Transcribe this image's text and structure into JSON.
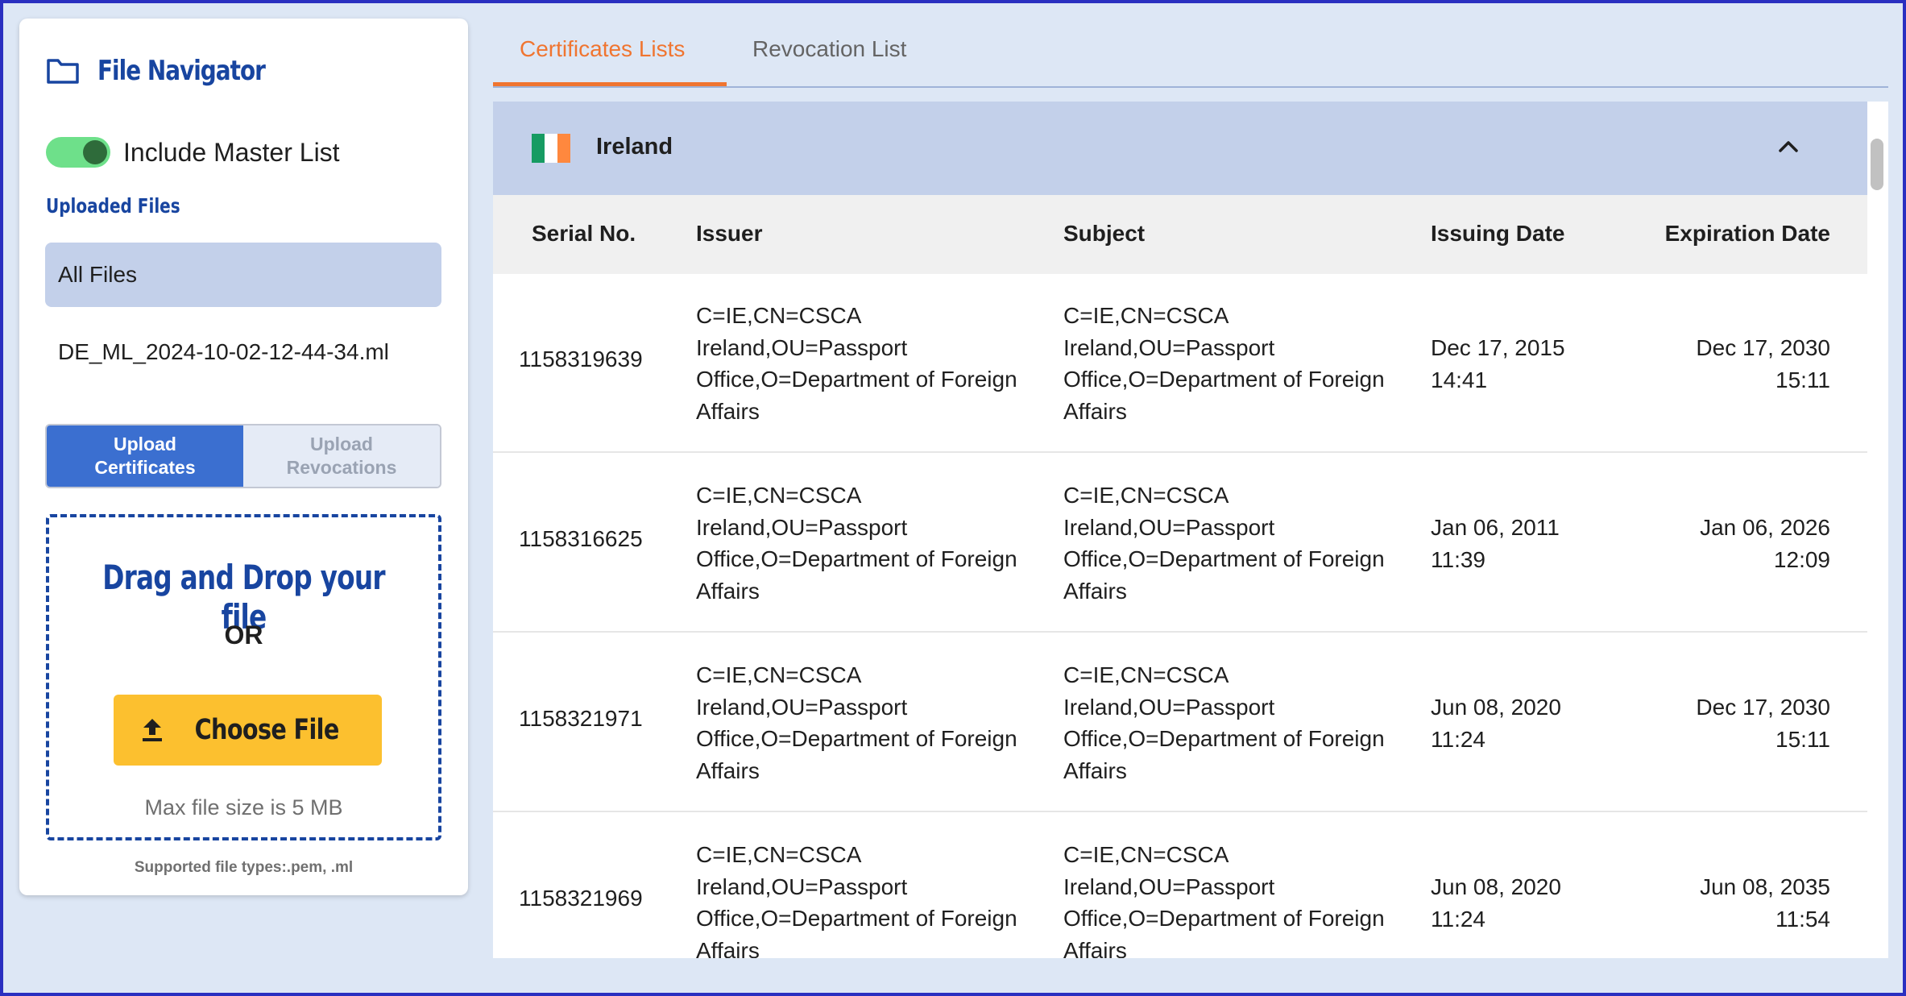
{
  "sidebar": {
    "title": "File Navigator",
    "include_master_label": "Include Master List",
    "include_master_on": true,
    "uploaded_files_label": "Uploaded Files",
    "files": [
      "All Files",
      "DE_ML_2024-10-02-12-44-34.ml"
    ],
    "selected_file": "All Files",
    "upload_modes": [
      "Upload\nCertificates",
      "Upload\nRevocations"
    ],
    "active_upload_mode": "Upload\nCertificates",
    "dropzone": {
      "title": "Drag and Drop your file",
      "or_text": "OR",
      "button_label": "Choose File",
      "max_size_text": "Max file size is 5 MB"
    },
    "supported_types": "Supported file types:.pem, .ml"
  },
  "tabs": [
    "Certificates Lists",
    "Revocation List"
  ],
  "active_tab": "Certificates Lists",
  "group": {
    "country": "Ireland",
    "expanded": true,
    "flag_colors": [
      "#169b62",
      "#ffffff",
      "#ff883e"
    ]
  },
  "table": {
    "columns": [
      "Serial No.",
      "Issuer",
      "Subject",
      "Issuing Date",
      "Expiration Date"
    ],
    "rows": [
      {
        "serial": "1158319639",
        "issuer": "C=IE,CN=CSCA Ireland,OU=Passport Office,O=Department of Foreign Affairs",
        "subject": "C=IE,CN=CSCA Ireland,OU=Passport Office,O=Department of Foreign Affairs",
        "issuing_date": "Dec 17, 2015 14:41",
        "expiration_date": "Dec 17, 2030 15:11"
      },
      {
        "serial": "1158316625",
        "issuer": "C=IE,CN=CSCA Ireland,OU=Passport Office,O=Department of Foreign Affairs",
        "subject": "C=IE,CN=CSCA Ireland,OU=Passport Office,O=Department of Foreign Affairs",
        "issuing_date": "Jan 06, 2011 11:39",
        "expiration_date": "Jan 06, 2026 12:09"
      },
      {
        "serial": "1158321971",
        "issuer": "C=IE,CN=CSCA Ireland,OU=Passport Office,O=Department of Foreign Affairs",
        "subject": "C=IE,CN=CSCA Ireland,OU=Passport Office,O=Department of Foreign Affairs",
        "issuing_date": "Jun 08, 2020 11:24",
        "expiration_date": "Dec 17, 2030 15:11"
      },
      {
        "serial": "1158321969",
        "issuer": "C=IE,CN=CSCA Ireland,OU=Passport Office,O=Department of Foreign Affairs",
        "subject": "C=IE,CN=CSCA Ireland,OU=Passport Office,O=Department of Foreign Affairs",
        "issuing_date": "Jun 08, 2020 11:24",
        "expiration_date": "Jun 08, 2035 11:54"
      }
    ]
  },
  "colors": {
    "accent_orange": "#f07530",
    "brand_blue": "#1845a0",
    "button_yellow": "#fcc02f",
    "toggle_green": "#6ee08a",
    "header_blue": "#c3d0ea"
  },
  "icons": {
    "title": "folder-icon",
    "choose_file": "upload-icon",
    "group_toggle": "chevron-up-icon"
  }
}
